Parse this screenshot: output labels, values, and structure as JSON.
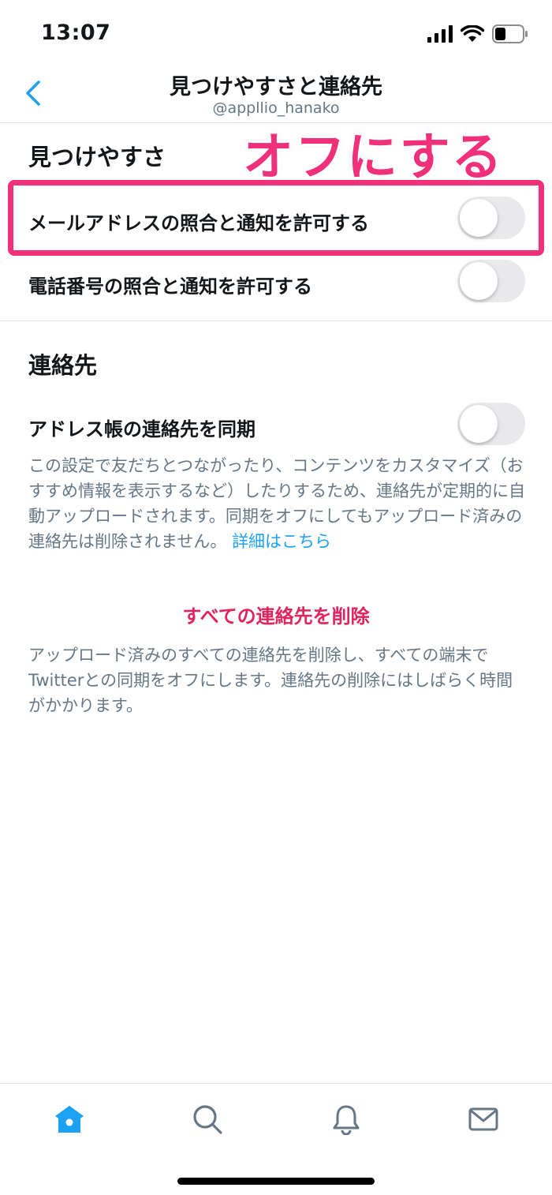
{
  "status_bar": {
    "time": "13:07"
  },
  "nav": {
    "title": "見つけやすさと連絡先",
    "subtitle": "@appllio_hanako"
  },
  "annotation": {
    "caption": "オフにする"
  },
  "discoverability": {
    "header": "見つけやすさ",
    "items": [
      {
        "label": "メールアドレスの照合と通知を許可する",
        "enabled": false
      },
      {
        "label": "電話番号の照合と通知を許可する",
        "enabled": false
      }
    ]
  },
  "contacts": {
    "header": "連絡先",
    "sync": {
      "label": "アドレス帳の連絡先を同期",
      "enabled": false
    },
    "sync_description": "この設定で友だちとつながったり、コンテンツをカスタマイズ（おすすめ情報を表示するなど）したりするため、連絡先が定期的に自動アップロードされます。同期をオフにしてもアップロード済みの連絡先は削除されません。",
    "learn_more": "詳細はこちら",
    "delete_label": "すべての連絡先を削除",
    "delete_description": "アップロード済みのすべての連絡先を削除し、すべての端末でTwitterとの同期をオフにします。連絡先の削除にはしばらく時間がかかります。"
  },
  "tabs": [
    {
      "name": "home",
      "icon": "home-icon",
      "active": true
    },
    {
      "name": "search",
      "icon": "search-icon",
      "active": false
    },
    {
      "name": "notifications",
      "icon": "bell-icon",
      "active": false
    },
    {
      "name": "messages",
      "icon": "mail-icon",
      "active": false
    }
  ],
  "colors": {
    "accent": "#1da1f2",
    "danger": "#e0245e",
    "annotation": "#f0307a",
    "secondary_text": "#657786"
  }
}
